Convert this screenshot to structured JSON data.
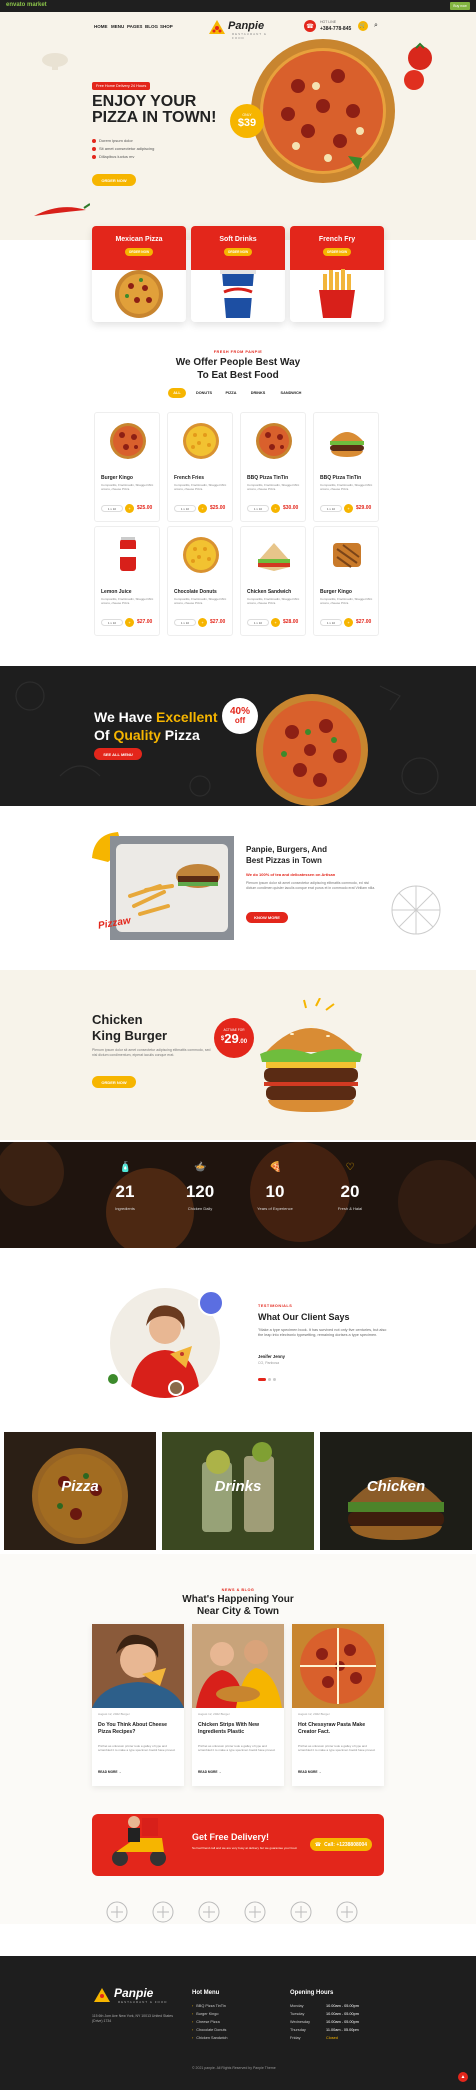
{
  "topbar": {
    "envato": "envato market",
    "purchase": "Buy now"
  },
  "nav": [
    "HOME",
    "MENU",
    "PAGES",
    "BLOG",
    "SHOP"
  ],
  "logo": {
    "name": "Panpie",
    "sub": "RESTAURANT & FOOD"
  },
  "contact": {
    "label": "HOT LINE",
    "phone": "+384-778-845"
  },
  "hero": {
    "badge": "Free Home Delivery 24 Hours",
    "title_line1": "ENJOY YOUR",
    "title_line2": "PIZZA IN TOWN!",
    "bullets": [
      "Dorem ipsum dolor",
      "Sit amet consectetur adipiscing",
      "Dillapibus luctus mv"
    ],
    "cta": "ORDER NOW",
    "price_label": "ONLY",
    "price": "$39"
  },
  "categories": [
    {
      "title": "Mexican Pizza",
      "btn": "ORDER NOW"
    },
    {
      "title": "Soft Drinks",
      "btn": "ORDER NOW"
    },
    {
      "title": "French Fry",
      "btn": "ORDER NOW"
    }
  ],
  "best_food": {
    "eyebrow": "FRESH FROM PANPIE",
    "title_line1": "We Offer People Best Way",
    "title_line2": "To Eat Best Food",
    "tabs": [
      "ALL",
      "DONUTS",
      "PIZZA",
      "DRINKS",
      "SANDWICH"
    ],
    "items": [
      {
        "name": "Burger Kingo",
        "price": "$25.00",
        "icon": "pizza"
      },
      {
        "name": "French Fries",
        "price": "$25.00",
        "icon": "corn-pizza"
      },
      {
        "name": "BBQ Pizza TinTin",
        "price": "$30.00",
        "icon": "pizza"
      },
      {
        "name": "BBQ Pizza TinTin",
        "price": "$29.00",
        "icon": "burger"
      },
      {
        "name": "Lemon Juice",
        "price": "$27.00",
        "icon": "can"
      },
      {
        "name": "Chocolate Donuts",
        "price": "$27.00",
        "icon": "corn-pizza"
      },
      {
        "name": "Chicken Sandwich",
        "price": "$28.00",
        "icon": "sandwich"
      },
      {
        "name": "Burger Kingo",
        "price": "$27.00",
        "icon": "toast"
      }
    ],
    "desc": "Compositlis, Fractimadin, Sbagget Mint onions, cheese Pizza",
    "qty_label": "1 x 10"
  },
  "dark_banner": {
    "line1a": "We Have ",
    "line1b": "Excellent",
    "line2a": "Of ",
    "line2b": "Quality",
    "line2c": " Pizza",
    "btn": "SEE ALL MENU",
    "badge_pct": "40%",
    "badge_off": "off"
  },
  "panpie_burgers": {
    "title_line1": "Panpie, Burgers, And",
    "title_line2": "Best Pizzas in Town",
    "sub": "We do 100% of tea and delicatessen on Artisan",
    "desc": "Plenum ipsum dolor sit amet consectetur adipiscing elitmattis commodo, ed nisl dictum condimen quisler iaculis conque erat purus et in commodo erat Viriliam nilla.",
    "btn": "KNOW MORE",
    "tag": "Pizzaw"
  },
  "chicken_king": {
    "title_line1": "Chicken",
    "title_line2": "King Burger",
    "desc": "Plenum ipsum dolor sit amet consectetur adipiscing elitmattis commodo, sed nisl dictum condimentum, eiperat iaculis conque erat.",
    "btn": "ORDER NOW",
    "price_label": "ACTIVAE FOR",
    "price_cur": "$",
    "price": "29",
    "price_dec": ".00"
  },
  "stats": [
    {
      "num": "21",
      "label": "Ingredients",
      "icon": "bottle"
    },
    {
      "num": "120",
      "label": "Chicken Daily",
      "icon": "bowl"
    },
    {
      "num": "10",
      "label": "Years of Experience",
      "icon": "pizza"
    },
    {
      "num": "20",
      "label": "Fresh & Halal",
      "icon": "heart"
    }
  ],
  "testimonial": {
    "eyebrow": "TESTIMONIALS",
    "title": "What Our Client Says",
    "quote": "\"Make a type specimen book. It has survived not only five centuries, but also the leap into electronic typesetting, remaining dorises a type specimen.",
    "name": "Jenifer Jenny",
    "role": "CO, Panbosa"
  },
  "galleries": [
    "Pizza",
    "Drinks",
    "Chicken"
  ],
  "news": {
    "eyebrow": "NEWS & BLOG",
    "title_line1": "What's Happening Your",
    "title_line2": "Near City & Town",
    "posts": [
      {
        "meta": "August 12, 2022   Burger",
        "title": "Do You Think About Cheese Pizza Recipes?",
        "text": "Prichet as unknown printer took a galley of type and scrambled it to make a type specimen bookit have proved."
      },
      {
        "meta": "August 12, 2022   Burger",
        "title": "Chicken Strips With New Ingredients Plastic",
        "text": "Prichet as unknown printer took a galley of type and scrambled it to make a type specimen bookit have proved."
      },
      {
        "meta": "August 12, 2022   Burger",
        "title": "Hot Chessyraw Pasta Make Creator Fact.",
        "text": "Prichet as unknown printer took a galley of type and scrambled it to make a type specimen bookit have proved."
      }
    ],
    "more": "READ MORE →"
  },
  "delivery": {
    "title": "Get Free Delivery!",
    "desc": "So had friend call and we are very busy at delivery but we guarantee your food.",
    "btn": "Call: +1238808004"
  },
  "brands": [
    "Brand 1",
    "Brand 2",
    "Brand 3",
    "Brand 4",
    "Brand 5",
    "Brand 6"
  ],
  "footer": {
    "logo": "Panpie",
    "logo_sub": "RESTAURANT & FOOD",
    "address": "115 6th Jom Ave New York, NY 10013 United States (Drive) 1734",
    "menu_heading": "Hot Menu",
    "menu": [
      "BBQ Pizza TinTin",
      "Burger Kingo",
      "Cheese Pizza",
      "Chocolate Donuts",
      "Chicken Sandwich"
    ],
    "hours_heading": "Opening Hours",
    "hours": [
      {
        "day": "Monday",
        "time": "10.00am - 05.00pm"
      },
      {
        "day": "Tuesday",
        "time": "10.00am - 05.00pm"
      },
      {
        "day": "Wednesday",
        "time": "10.00am - 05.00pm"
      },
      {
        "day": "Thursday",
        "time": "11.00am - 05.00pm"
      },
      {
        "day": "Friday",
        "time": "Closed"
      }
    ],
    "copyright": "© 2021 panpie. All Rights Reserved by Panpie Theme"
  }
}
